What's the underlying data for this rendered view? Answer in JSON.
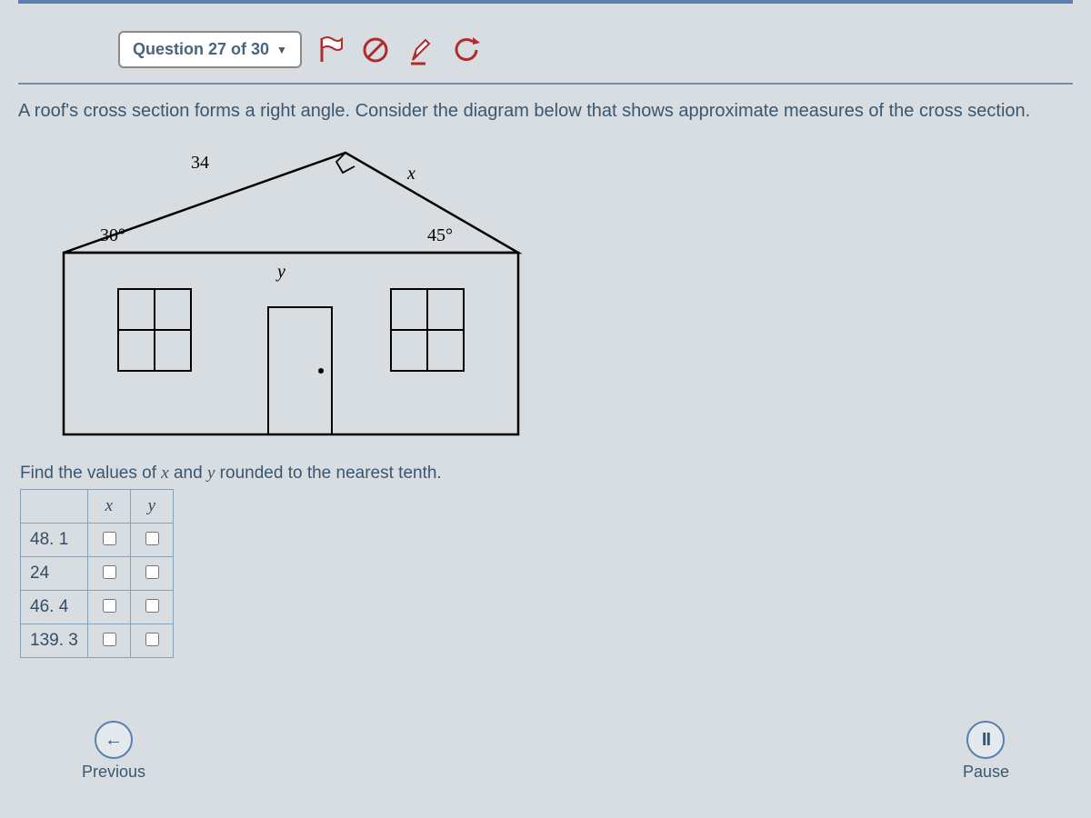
{
  "toolbar": {
    "question_label": "Question 27 of 30",
    "icons": [
      "flag",
      "clear",
      "pen",
      "refresh"
    ]
  },
  "prompt": "A roof's cross section forms a right angle.  Consider the diagram below that shows approximate measures of the cross section.",
  "diagram": {
    "left_angle": "30°",
    "right_angle": "45°",
    "left_side": "34",
    "x_label": "x",
    "y_label": "y"
  },
  "instruction_prefix": "Find the values of ",
  "xvar": "x",
  "instruction_mid": " and ",
  "yvar": "y",
  "instruction_suffix": " rounded to the nearest tenth.",
  "headers": {
    "x": "x",
    "y": "y"
  },
  "rows": [
    {
      "val": "48. 1"
    },
    {
      "val": "24"
    },
    {
      "val": "46. 4"
    },
    {
      "val": "139. 3"
    }
  ],
  "nav": {
    "prev": "Previous",
    "pause": "Pause"
  }
}
